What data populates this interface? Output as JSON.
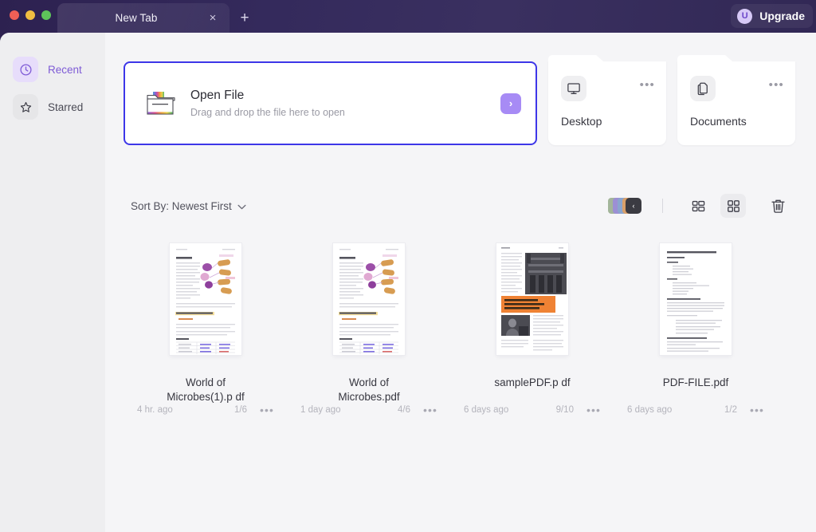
{
  "window": {
    "traffic_lights": [
      "close",
      "minimize",
      "maximize"
    ],
    "tab_title": "New Tab",
    "close_icon": "×",
    "new_tab_icon": "+",
    "upgrade_label": "Upgrade",
    "upgrade_avatar_initial": "U"
  },
  "sidebar": {
    "items": [
      {
        "label": "Recent",
        "icon": "clock-icon",
        "active": true
      },
      {
        "label": "Starred",
        "icon": "star-icon",
        "active": false
      }
    ]
  },
  "open_file": {
    "title": "Open File",
    "subtitle": "Drag and drop the file here to open",
    "arrow_icon": "›",
    "icon": "folder-icon",
    "focus_border_color": "#3d36e8"
  },
  "quick_cards": [
    {
      "label": "Desktop",
      "icon": "monitor-icon",
      "menu_icon": "•••"
    },
    {
      "label": "Documents",
      "icon": "documents-icon",
      "menu_icon": "•••"
    }
  ],
  "toolbar": {
    "sort_label": "Sort By: Newest First",
    "sort_chevron": "⌄",
    "stack_colors": [
      "#a3b59a",
      "#9c8fd4",
      "#8aa5cf",
      "#d9a06a",
      "#e8c3a3"
    ],
    "stack_button_icon": "‹",
    "list_view_icon": "list-view-icon",
    "grid_view_icon": "grid-view-icon",
    "grid_view_active": true,
    "trash_icon": "trash-icon"
  },
  "files": [
    {
      "name": "World of Microbes(1).p df",
      "modified": "4 hr. ago",
      "pages": "1/6",
      "menu_icon": "•••",
      "thumb_type": "microbes"
    },
    {
      "name": "World of Microbes.pdf",
      "modified": "1 day ago",
      "pages": "4/6",
      "menu_icon": "•••",
      "thumb_type": "microbes"
    },
    {
      "name": "samplePDF.p df",
      "modified": "6 days ago",
      "pages": "9/10",
      "menu_icon": "•••",
      "thumb_type": "sample"
    },
    {
      "name": "PDF-FILE.pdf",
      "modified": "6 days ago",
      "pages": "1/2",
      "menu_icon": "•••",
      "thumb_type": "text"
    }
  ]
}
